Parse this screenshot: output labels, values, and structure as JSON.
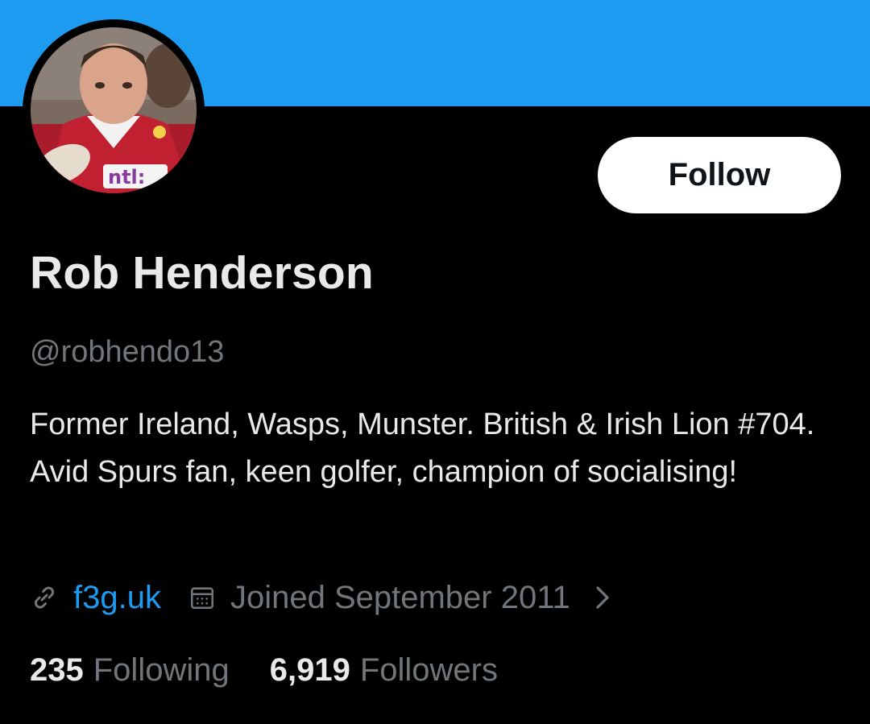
{
  "theme": {
    "banner_color": "#1d9bf0",
    "link_color": "#1d9bf0",
    "text_primary": "#e7e9ea",
    "text_secondary": "#71767b",
    "background": "#000000"
  },
  "profile": {
    "display_name": "Rob Henderson",
    "handle": "@robhendo13",
    "bio": "Former Ireland, Wasps, Munster. British & Irish Lion #704. Avid Spurs fan, keen golfer, champion of socialising!",
    "avatar_icon": "profile-photo",
    "website": "f3g.uk",
    "joined": "Joined September 2011"
  },
  "actions": {
    "follow_label": "Follow"
  },
  "stats": [
    {
      "count": "235",
      "label": "Following"
    },
    {
      "count": "6,919",
      "label": "Followers"
    }
  ],
  "icons": {
    "link": "link-icon",
    "calendar": "calendar-icon",
    "chevron": "chevron-right-icon"
  }
}
